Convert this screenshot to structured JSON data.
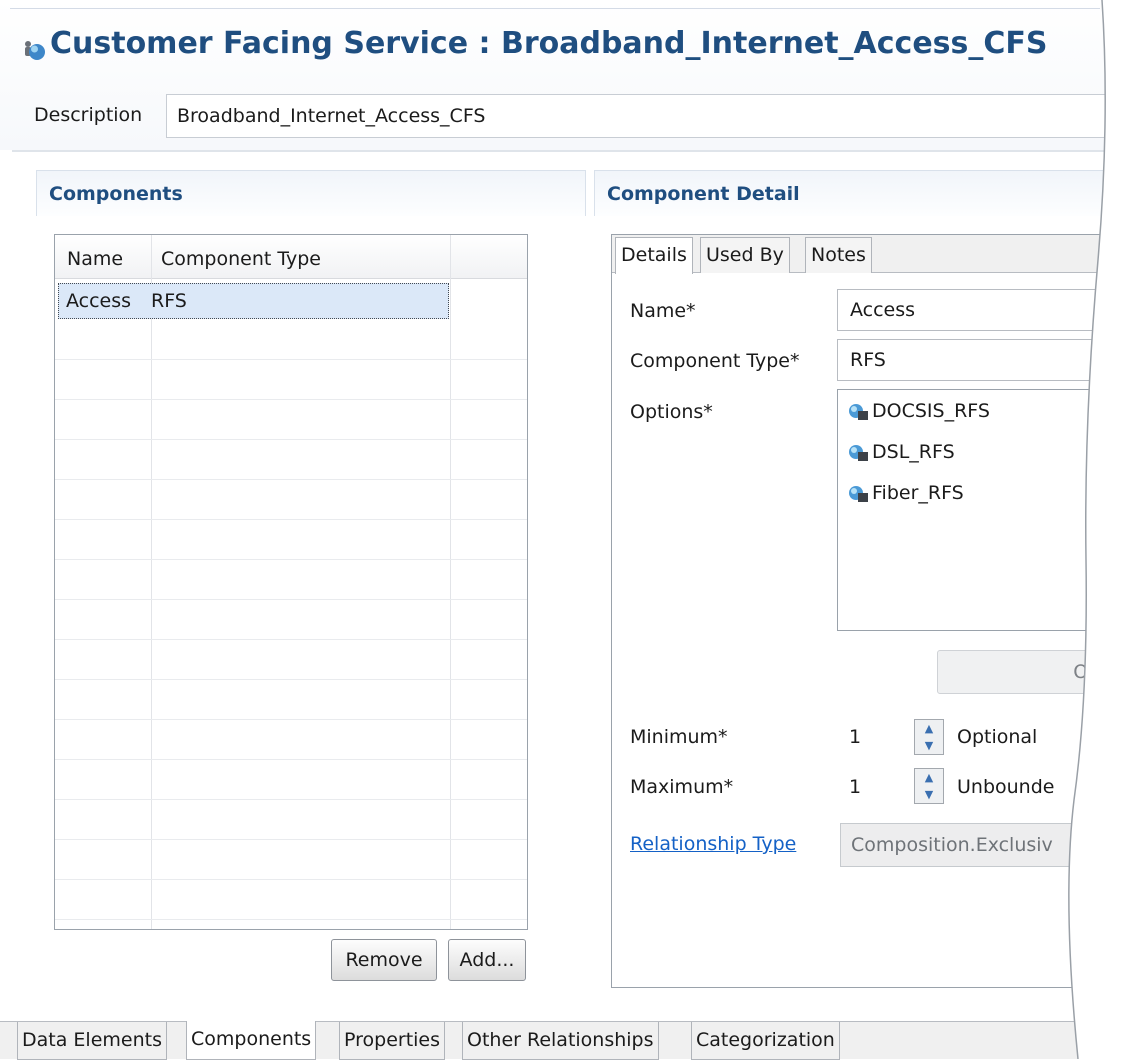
{
  "header": {
    "title": "Customer Facing Service : Broadband_Internet_Access_CFS",
    "description_label": "Description",
    "description_value": "Broadband_Internet_Access_CFS"
  },
  "components": {
    "header": "Components",
    "columns": [
      "Name",
      "Component Type"
    ],
    "rows": [
      {
        "name": "Access",
        "type": "RFS"
      }
    ],
    "remove_label": "Remove",
    "add_label": "Add..."
  },
  "detail": {
    "header": "Component Detail",
    "tabs": [
      "Details",
      "Used By",
      "Notes"
    ],
    "active_tab": "Details",
    "name_label": "Name*",
    "name_value": "Access",
    "type_label": "Component Type*",
    "type_value": "RFS",
    "options_label": "Options*",
    "options": [
      "DOCSIS_RFS",
      "DSL_RFS",
      "Fiber_RFS"
    ],
    "open_label": "Open",
    "minimum_label": "Minimum*",
    "minimum_value": "1",
    "optional_label": "Optional",
    "maximum_label": "Maximum*",
    "maximum_value": "1",
    "unbounded_label": "Unbounde",
    "relationship_link": "Relationship Type",
    "relationship_value": "Composition.Exclusiv"
  },
  "bottom_tabs": [
    "Data Elements",
    "Components",
    "Properties",
    "Other Relationships",
    "Categorization"
  ],
  "active_bottom_tab": "Components",
  "colors": {
    "title": "#1f4e80",
    "link": "#1461c6",
    "selection": "#dbe8f8"
  }
}
